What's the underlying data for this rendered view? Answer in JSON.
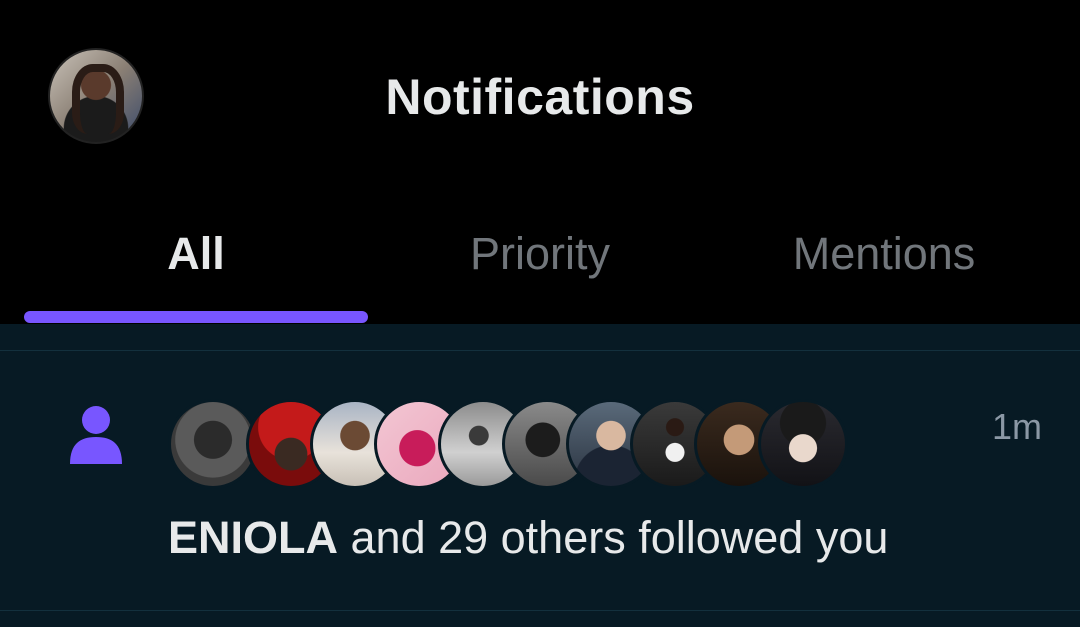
{
  "header": {
    "title": "Notifications",
    "profile_avatar": "profile-photo"
  },
  "tabs": [
    {
      "label": "All",
      "active": true
    },
    {
      "label": "Priority",
      "active": false
    },
    {
      "label": "Mentions",
      "active": false
    }
  ],
  "accent_color": "#7856ff",
  "notification": {
    "icon": "person-icon",
    "timestamp": "1m",
    "actor": "ENIOLA",
    "text": " and 29 others followed you",
    "avatars": [
      "avatar-1",
      "avatar-2",
      "avatar-3",
      "avatar-4",
      "avatar-5",
      "avatar-6",
      "avatar-7",
      "avatar-8",
      "avatar-9",
      "avatar-10"
    ]
  }
}
